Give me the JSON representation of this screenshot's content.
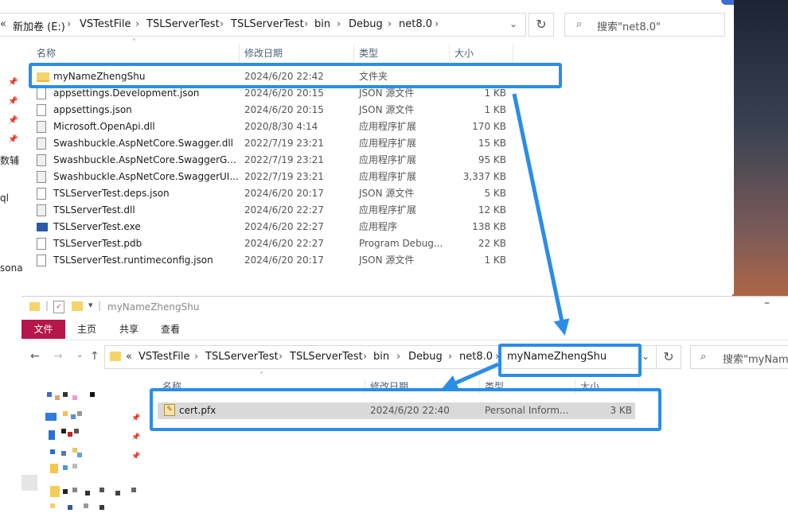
{
  "top_window": {
    "address": {
      "overflow": "«",
      "parts": [
        "新加卷 (E:)",
        "VSTestFile",
        "TSLServerTest",
        "TSLServerTest",
        "bin",
        "Debug",
        "net8.0"
      ],
      "separator": "›"
    },
    "search_placeholder": "搜索\"net8.0\"",
    "columns": [
      "名称",
      "修改日期",
      "类型",
      "大小"
    ],
    "sidebar_fragments": [
      "数辅",
      "ql",
      "sona"
    ],
    "files": [
      {
        "name": "myNameZhengShu",
        "date": "2024/6/20 22:42",
        "type": "文件夹",
        "size": "",
        "icon": "folder-icon"
      },
      {
        "name": "appsettings.Development.json",
        "date": "2024/6/20 20:15",
        "type": "JSON 源文件",
        "size": "1 KB",
        "icon": "file-icon"
      },
      {
        "name": "appsettings.json",
        "date": "2024/6/20 20:15",
        "type": "JSON 源文件",
        "size": "1 KB",
        "icon": "file-icon"
      },
      {
        "name": "Microsoft.OpenApi.dll",
        "date": "2020/8/30 4:14",
        "type": "应用程序扩展",
        "size": "170 KB",
        "icon": "dll-icon"
      },
      {
        "name": "Swashbuckle.AspNetCore.Swagger.dll",
        "date": "2022/7/19 23:21",
        "type": "应用程序扩展",
        "size": "15 KB",
        "icon": "dll-icon"
      },
      {
        "name": "Swashbuckle.AspNetCore.SwaggerG...",
        "date": "2022/7/19 23:21",
        "type": "应用程序扩展",
        "size": "95 KB",
        "icon": "dll-icon"
      },
      {
        "name": "Swashbuckle.AspNetCore.SwaggerUI...",
        "date": "2022/7/19 23:21",
        "type": "应用程序扩展",
        "size": "3,337 KB",
        "icon": "dll-icon"
      },
      {
        "name": "TSLServerTest.deps.json",
        "date": "2024/6/20 20:17",
        "type": "JSON 源文件",
        "size": "5 KB",
        "icon": "file-icon"
      },
      {
        "name": "TSLServerTest.dll",
        "date": "2024/6/20 22:27",
        "type": "应用程序扩展",
        "size": "12 KB",
        "icon": "dll-icon"
      },
      {
        "name": "TSLServerTest.exe",
        "date": "2024/6/20 22:27",
        "type": "应用程序",
        "size": "138 KB",
        "icon": "exe-icon"
      },
      {
        "name": "TSLServerTest.pdb",
        "date": "2024/6/20 22:27",
        "type": "Program Debug...",
        "size": "22 KB",
        "icon": "file-icon"
      },
      {
        "name": "TSLServerTest.runtimeconfig.json",
        "date": "2024/6/20 20:17",
        "type": "JSON 源文件",
        "size": "1 KB",
        "icon": "file-icon"
      }
    ]
  },
  "bottom_window": {
    "title": "myNameZhengShu",
    "ribbon_tabs": [
      "文件",
      "主页",
      "共享",
      "查看"
    ],
    "address": {
      "overflow": "«",
      "parts": [
        "VSTestFile",
        "TSLServerTest",
        "TSLServerTest",
        "bin",
        "Debug",
        "net8.0",
        "myNameZhengShu"
      ]
    },
    "search_placeholder": "搜索\"myNameZ",
    "columns": [
      "名称",
      "修改日期",
      "类型",
      "大小"
    ],
    "files": [
      {
        "name": "cert.pfx",
        "date": "2024/6/20 22:40",
        "type": "Personal Inform...",
        "size": "3 KB",
        "icon": "certificate-icon"
      }
    ]
  },
  "colors": {
    "highlight": "#2b8de6",
    "file_tab": "#b5174a",
    "folder": "#f7d36b"
  }
}
